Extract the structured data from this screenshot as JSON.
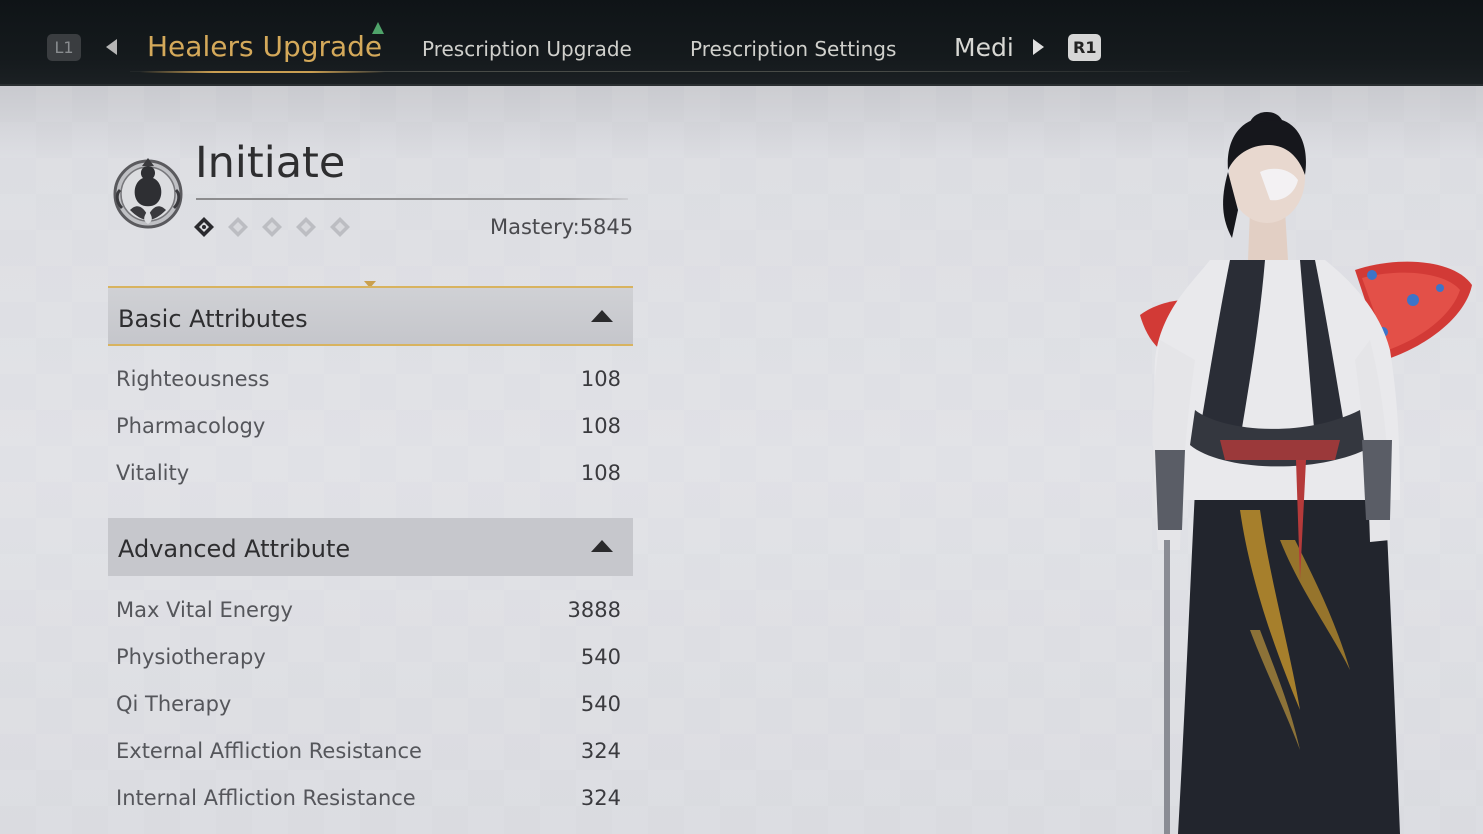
{
  "tabs": {
    "left_button": "L1",
    "right_button": "R1",
    "active": "Healers Upgrade",
    "items": [
      "Prescription Upgrade",
      "Prescription Settings",
      "Medi"
    ]
  },
  "rank": {
    "title": "Initiate",
    "mastery_text": "Mastery:5845",
    "stars_filled": 1,
    "stars_total": 5
  },
  "basic": {
    "header": "Basic Attributes",
    "rows": [
      {
        "name": "Righteousness",
        "value": "108"
      },
      {
        "name": "Pharmacology",
        "value": "108"
      },
      {
        "name": "Vitality",
        "value": "108"
      }
    ]
  },
  "advanced": {
    "header": "Advanced Attribute",
    "rows": [
      {
        "name": "Max Vital Energy",
        "value": "3888"
      },
      {
        "name": "Physiotherapy",
        "value": "540"
      },
      {
        "name": "Qi Therapy",
        "value": "540"
      },
      {
        "name": "External Affliction Resistance",
        "value": "324"
      },
      {
        "name": "Internal Affliction Resistance",
        "value": "324"
      }
    ]
  },
  "colors": {
    "accent_gold": "#d4a95a",
    "tab_indicator": "#4fa46a"
  }
}
